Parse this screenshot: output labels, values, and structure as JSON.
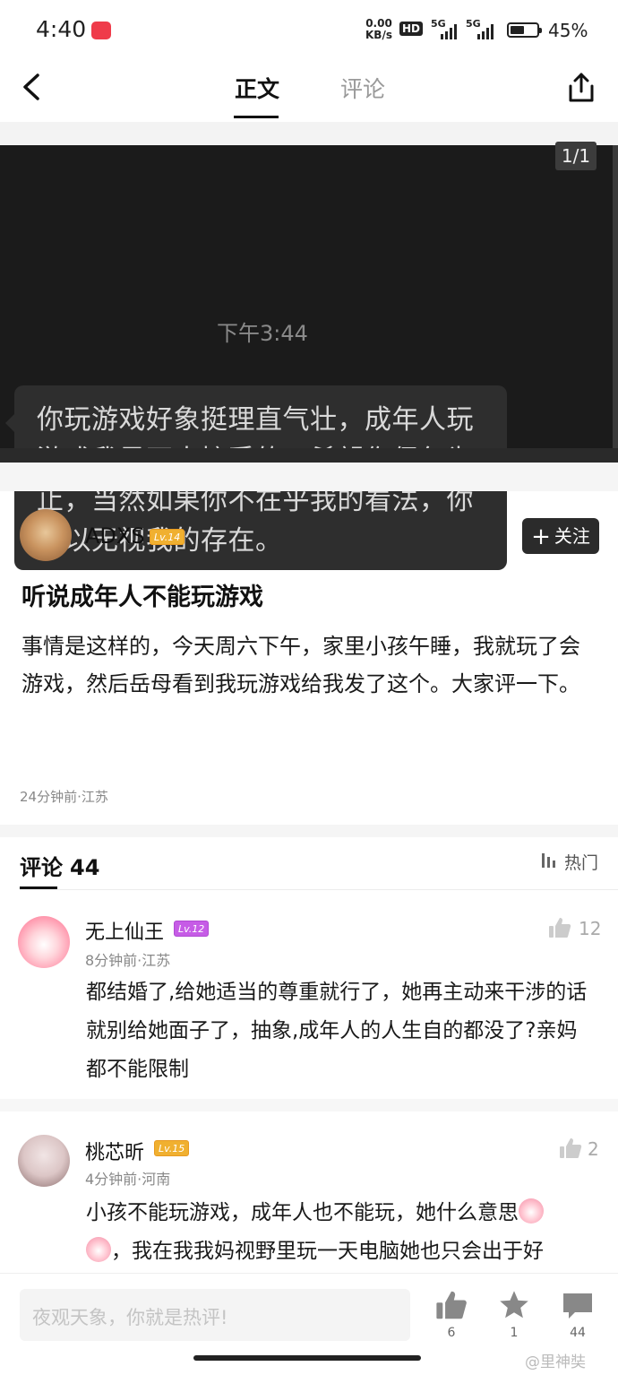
{
  "status_bar": {
    "time": "4:40",
    "net_speed_value": "0.00",
    "net_speed_unit": "KB/s",
    "hd_badge": "HD",
    "signal_1": "5G",
    "signal_2": "5G",
    "battery": "45%"
  },
  "nav": {
    "tab_main": "正文",
    "tab_comments": "评论"
  },
  "image": {
    "counter": "1/1",
    "chat_time": "下午3:44",
    "message": "你玩游戏好象挺理直气壮，成年人玩游戏我是不太接受的，希望你偶尔为止，当然如果你不在乎我的看法，你可以无视我的存在。"
  },
  "author": {
    "name": "ADXS",
    "level": "Lv.14",
    "follow_label": "关注"
  },
  "post": {
    "title": "听说成年人不能玩游戏",
    "body": "事情是这样的，今天周六下午，家里小孩午睡，我就玩了会游戏，然后岳母看到我玩游戏给我发了这个。大家评一下。",
    "meta": "24分钟前·江苏"
  },
  "comments_header": {
    "title": "评论",
    "count": "44",
    "sort_label": "热门"
  },
  "comments": [
    {
      "name": "无上仙王",
      "level": "Lv.12",
      "meta": "8分钟前·江苏",
      "text": "都结婚了,给她适当的尊重就行了，她再主动来干涉的话就别给她面子了，抽象,成年人的人生自的都没了?亲妈都不能限制",
      "likes": "12"
    },
    {
      "name": "桃芯昕",
      "level": "Lv.15",
      "meta": "4分钟前·河南",
      "text_part1": "小孩不能玩游戏，成年人也不能玩，她什么意思",
      "text_part2": "，我在我我妈视野里玩一天电脑她也只会出于好",
      "likes": "2"
    }
  ],
  "bottom_bar": {
    "input_placeholder": "夜观天象，你就是热评!",
    "like_count": "6",
    "favorite_count": "1",
    "comment_count": "44"
  },
  "watermark": "@里神奘"
}
